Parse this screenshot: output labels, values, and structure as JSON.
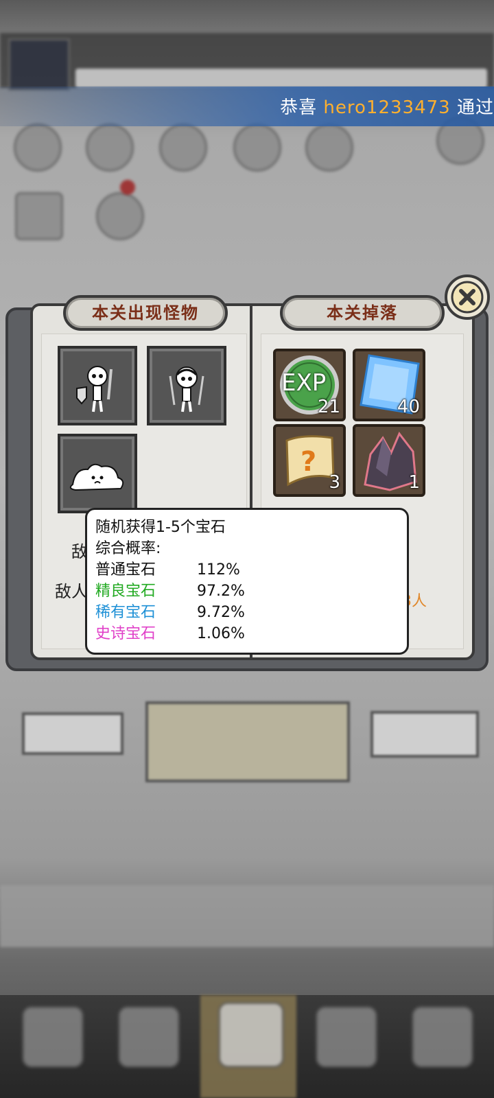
{
  "ticker": {
    "prefix": "恭喜",
    "player": "hero1233473",
    "suffix": "通过"
  },
  "book": {
    "monsters_title": "本关出现怪物",
    "drops_title": "本关掉落",
    "monsters": [
      {
        "name": "skeleton-shield-icon"
      },
      {
        "name": "bandana-skeleton-icon"
      },
      {
        "name": "slime-icon"
      }
    ],
    "drops": [
      {
        "icon": "exp-icon",
        "label": "EXP",
        "count": "21"
      },
      {
        "icon": "blue-gem-icon",
        "count": "40"
      },
      {
        "icon": "scroll-icon",
        "count": "3"
      },
      {
        "icon": "crystal-ore-icon",
        "count": "1"
      }
    ],
    "enemy_partial_1": "敌",
    "enemy_partial_2": "敌人",
    "enemy_partial_3": "3人"
  },
  "tooltip": {
    "line1": "随机获得1-5个宝石",
    "line2": "综合概率:",
    "rows": [
      {
        "k": "普通宝石",
        "v": "112%",
        "color": "#111111"
      },
      {
        "k": "精良宝石",
        "v": "97.2%",
        "color": "#22aa22"
      },
      {
        "k": "稀有宝石",
        "v": "9.72%",
        "color": "#1e90d6"
      },
      {
        "k": "史诗宝石",
        "v": "1.06%",
        "color": "#e040c8"
      }
    ]
  }
}
